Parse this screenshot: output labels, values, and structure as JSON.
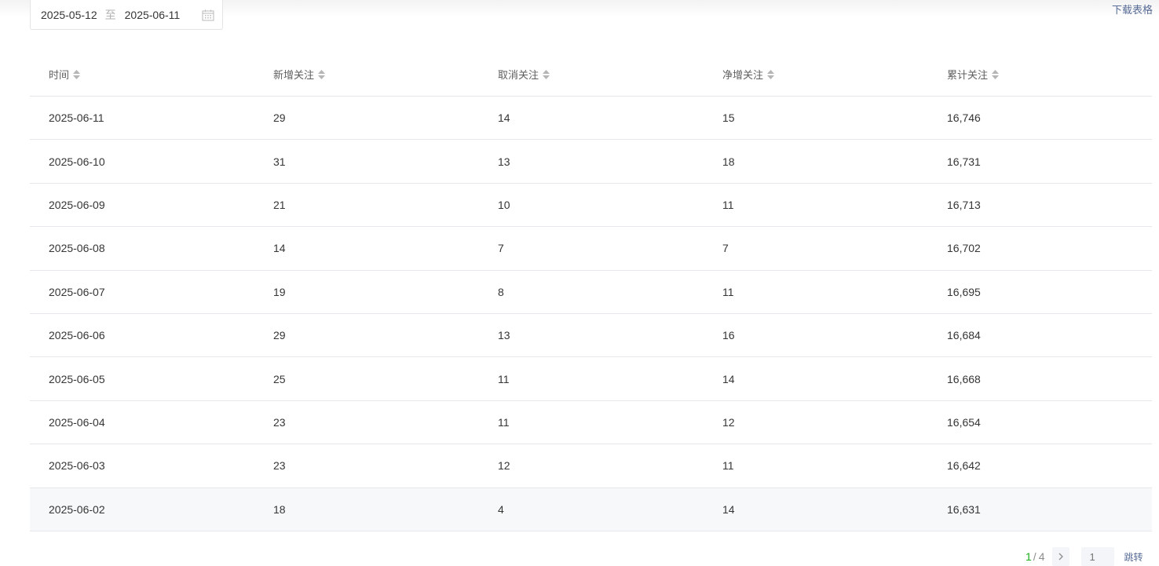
{
  "filter": {
    "start_date": "2025-05-12",
    "separator": "至",
    "end_date": "2025-06-11"
  },
  "download_label": "下载表格",
  "table": {
    "headers": [
      "时间",
      "新增关注",
      "取消关注",
      "净增关注",
      "累计关注"
    ],
    "rows": [
      [
        "2025-06-11",
        "29",
        "14",
        "15",
        "16,746"
      ],
      [
        "2025-06-10",
        "31",
        "13",
        "18",
        "16,731"
      ],
      [
        "2025-06-09",
        "21",
        "10",
        "11",
        "16,713"
      ],
      [
        "2025-06-08",
        "14",
        "7",
        "7",
        "16,702"
      ],
      [
        "2025-06-07",
        "19",
        "8",
        "11",
        "16,695"
      ],
      [
        "2025-06-06",
        "29",
        "13",
        "16",
        "16,684"
      ],
      [
        "2025-06-05",
        "25",
        "11",
        "14",
        "16,668"
      ],
      [
        "2025-06-04",
        "23",
        "11",
        "12",
        "16,654"
      ],
      [
        "2025-06-03",
        "23",
        "12",
        "11",
        "16,642"
      ],
      [
        "2025-06-02",
        "18",
        "4",
        "14",
        "16,631"
      ]
    ]
  },
  "pagination": {
    "current": "1",
    "separator": "/",
    "total": "4",
    "input_placeholder": "1",
    "jump_label": "跳转"
  },
  "colors": {
    "accent_green": "#1aad19",
    "link_blue": "#576b95"
  },
  "icons": [
    "calendar-icon",
    "sort-icon",
    "chevron-right-icon"
  ]
}
